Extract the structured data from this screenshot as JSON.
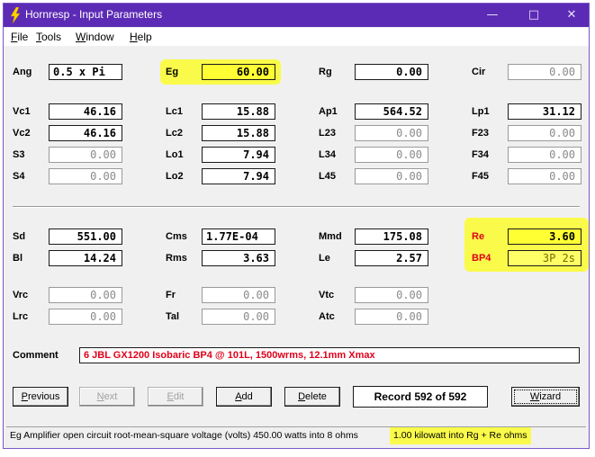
{
  "window": {
    "title": "Hornresp - Input Parameters",
    "controls": {
      "minimize": "—",
      "maximize": "□",
      "close": "✕"
    },
    "accent": "#5c2bb5"
  },
  "menu": [
    {
      "pre": "",
      "u": "F",
      "post": "ile"
    },
    {
      "pre": "",
      "u": "T",
      "post": "ools"
    },
    {
      "pre": "",
      "u": "W",
      "post": "indow"
    },
    {
      "pre": "",
      "u": "H",
      "post": "elp"
    }
  ],
  "top_params": {
    "ang": {
      "label": "Ang",
      "value": "0.5 x Pi"
    },
    "eg": {
      "label": "Eg",
      "value": "60.00"
    },
    "rg": {
      "label": "Rg",
      "value": "0.00"
    },
    "cir": {
      "label": "Cir",
      "value": "0.00"
    },
    "vc1": {
      "label": "Vc1",
      "value": "46.16"
    },
    "lc1": {
      "label": "Lc1",
      "value": "15.88"
    },
    "ap1": {
      "label": "Ap1",
      "value": "564.52"
    },
    "lp1": {
      "label": "Lp1",
      "value": "31.12"
    },
    "vc2": {
      "label": "Vc2",
      "value": "46.16"
    },
    "lc2": {
      "label": "Lc2",
      "value": "15.88"
    },
    "l23": {
      "label": "L23",
      "value": "0.00"
    },
    "f23": {
      "label": "F23",
      "value": "0.00"
    },
    "s3": {
      "label": "S3",
      "value": "0.00"
    },
    "lo1": {
      "label": "Lo1",
      "value": "7.94"
    },
    "l34": {
      "label": "L34",
      "value": "0.00"
    },
    "f34": {
      "label": "F34",
      "value": "0.00"
    },
    "s4": {
      "label": "S4",
      "value": "0.00"
    },
    "lo2": {
      "label": "Lo2",
      "value": "7.94"
    },
    "l45": {
      "label": "L45",
      "value": "0.00"
    },
    "f45": {
      "label": "F45",
      "value": "0.00"
    }
  },
  "driver_params": {
    "sd": {
      "label": "Sd",
      "value": "551.00"
    },
    "cms": {
      "label": "Cms",
      "value": "1.77E-04"
    },
    "mmd": {
      "label": "Mmd",
      "value": "175.08"
    },
    "re": {
      "label": "Re",
      "value": "3.60"
    },
    "bl": {
      "label": "Bl",
      "value": "14.24"
    },
    "rms": {
      "label": "Rms",
      "value": "3.63"
    },
    "le": {
      "label": "Le",
      "value": "2.57"
    },
    "bp4": {
      "label": "BP4",
      "value": "3P 2s"
    },
    "vrc": {
      "label": "Vrc",
      "value": "0.00"
    },
    "fr": {
      "label": "Fr",
      "value": "0.00"
    },
    "vtc": {
      "label": "Vtc",
      "value": "0.00"
    },
    "lrc": {
      "label": "Lrc",
      "value": "0.00"
    },
    "tal": {
      "label": "Tal",
      "value": "0.00"
    },
    "atc": {
      "label": "Atc",
      "value": "0.00"
    }
  },
  "comment": {
    "label": "Comment",
    "value": "6 JBL GX1200 Isobaric BP4 @ 101L, 1500wrms, 12.1mm Xmax"
  },
  "buttons": {
    "previous": {
      "u": "P",
      "post": "revious"
    },
    "next": {
      "u": "N",
      "post": "ext"
    },
    "edit": {
      "u": "E",
      "post": "dit"
    },
    "add": {
      "u": "A",
      "post": "dd"
    },
    "delete": {
      "u": "D",
      "post": "elete"
    },
    "wizard": {
      "u": "W",
      "post": "izard"
    }
  },
  "record": "Record 592 of 592",
  "status": {
    "text": "Eg  Amplifier open circuit root-mean-square voltage  (volts)  450.00 watts into 8 ohms",
    "highlight": "1.00 kilowatt into Rg + Re ohms"
  },
  "highlight_color": "#fafa4a",
  "label_red": "#e0001a"
}
